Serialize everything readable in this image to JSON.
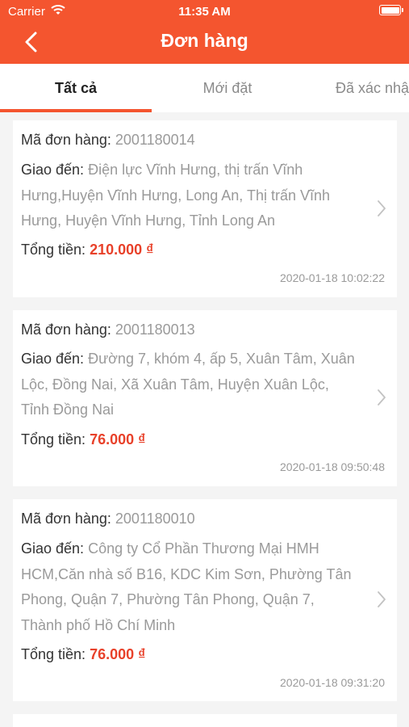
{
  "status_bar": {
    "carrier": "Carrier",
    "time": "11:35 AM"
  },
  "nav": {
    "title": "Đơn hàng"
  },
  "tabs": [
    {
      "label": "Tất cả",
      "active": true
    },
    {
      "label": "Mới đặt",
      "active": false
    },
    {
      "label": "Đã xác nhận",
      "active": false
    }
  ],
  "labels": {
    "order_id": "Mã đơn hàng:",
    "ship_to": "Giao đến:",
    "total": "Tổng tiền:"
  },
  "orders": [
    {
      "id": "2001180014",
      "address_lines": [
        "Điện lực Vĩnh Hưng, thị trấn Vĩnh",
        "Hưng,Huyện Vĩnh Hưng, Long An, Thị trấn Vĩnh",
        "Hưng, Huyện Vĩnh Hưng, Tỉnh Long An"
      ],
      "total": "210.000 ₫",
      "datetime": "2020-01-18 10:02:22"
    },
    {
      "id": "2001180013",
      "address_lines": [
        "Đường 7, khóm 4, ấp 5, Xuân Tâm, Xuân",
        "Lộc, Đồng Nai, Xã Xuân Tâm, Huyện Xuân Lộc,",
        "Tỉnh Đồng Nai"
      ],
      "total": "76.000 ₫",
      "datetime": "2020-01-18 09:50:48"
    },
    {
      "id": "2001180010",
      "address_lines": [
        "Công ty Cổ Phần Thương Mại HMH",
        "HCM,Căn nhà số B16, KDC Kim Sơn, Phường Tân",
        "Phong, Quận 7, Phường Tân Phong, Quận 7,",
        "Thành phố Hồ Chí Minh"
      ],
      "total": "76.000 ₫",
      "datetime": "2020-01-18 09:31:20"
    }
  ],
  "colors": {
    "accent": "#f4552f",
    "price": "#e8412a"
  }
}
